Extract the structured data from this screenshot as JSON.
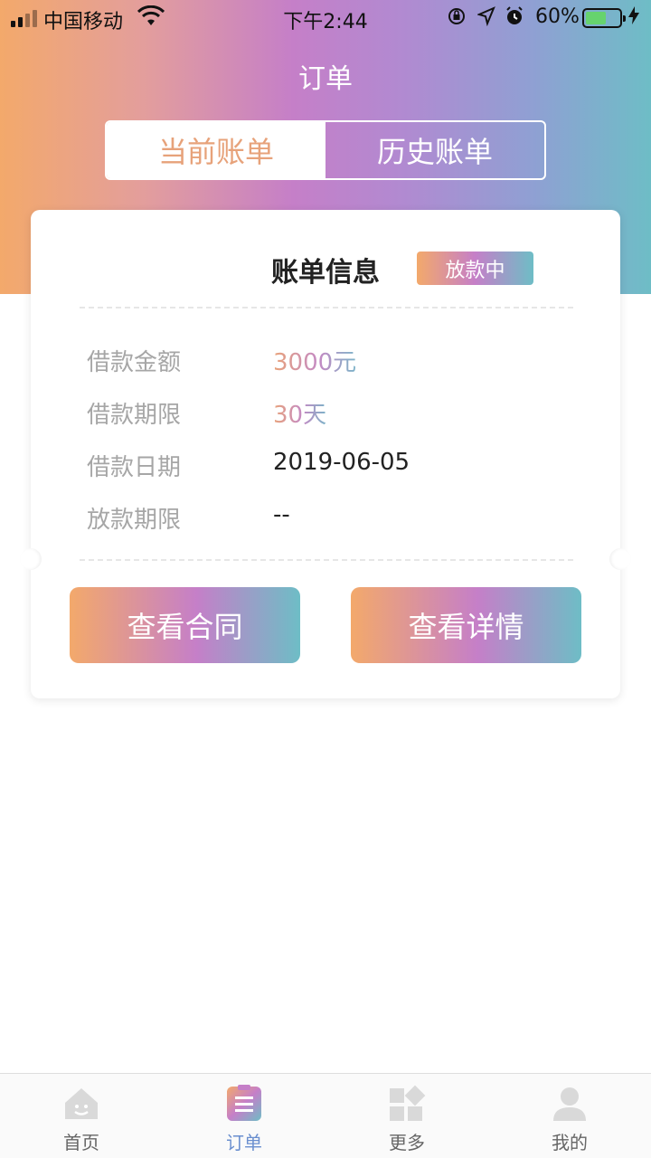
{
  "status_bar": {
    "carrier": "中国移动",
    "time": "下午2:44",
    "battery": "60%",
    "battery_level": 0.6,
    "icons": [
      "signal-icon",
      "wifi-icon",
      "rotation-lock-icon",
      "location-icon",
      "alarm-icon",
      "battery-icon",
      "charging-icon"
    ]
  },
  "nav": {
    "title": "订单"
  },
  "segment": {
    "tabs": [
      "当前账单",
      "历史账单"
    ],
    "active": 0
  },
  "card": {
    "title": "账单信息",
    "badge": "放款中",
    "rows": [
      {
        "label": "借款金额",
        "value": "3000元"
      },
      {
        "label": "借款期限",
        "value": "30天"
      },
      {
        "label": "借款日期",
        "value": "2019-06-05"
      },
      {
        "label": "放款期限",
        "value": "--"
      }
    ],
    "buttons": [
      "查看合同",
      "查看详情"
    ]
  },
  "tabbar": {
    "items": [
      {
        "label": "首页",
        "icon": "home-icon"
      },
      {
        "label": "订单",
        "icon": "order-icon"
      },
      {
        "label": "更多",
        "icon": "grid-icon"
      },
      {
        "label": "我的",
        "icon": "user-icon"
      }
    ],
    "active": 1
  },
  "colors": {
    "accent_orange": "#f3a96b",
    "accent_purple": "#c57fc8",
    "accent_teal": "#6ebdc6",
    "tab_active": "#6a8fcf"
  }
}
